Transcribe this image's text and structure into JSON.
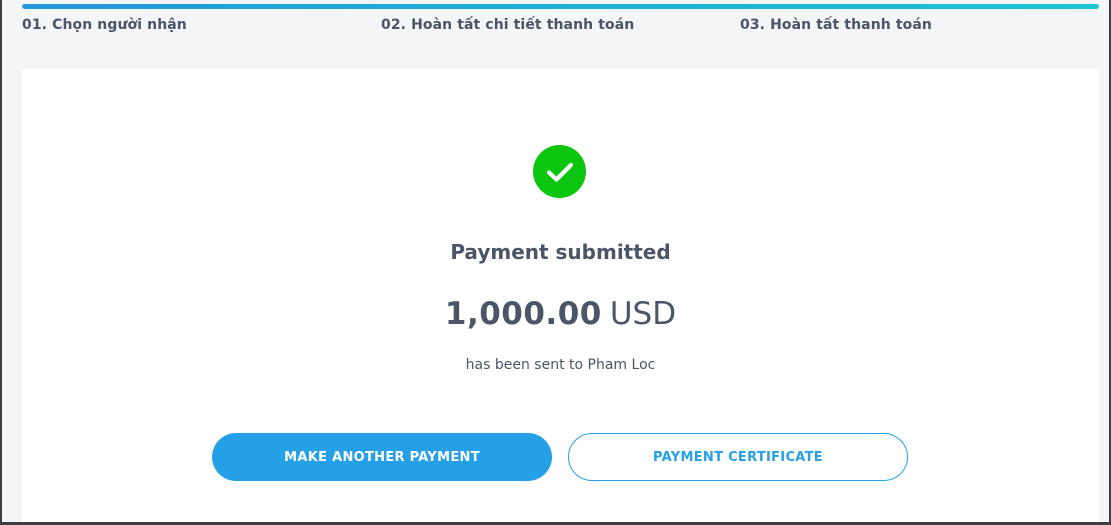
{
  "progress": {
    "current_step": 3,
    "total_steps": 3,
    "fraction_complete": 1.0,
    "gradient_start": "#2297db",
    "gradient_end": "#1cc4d1"
  },
  "steps": [
    {
      "label": "01. Chọn người nhận"
    },
    {
      "label": "02. Hoàn tất chi tiết thanh toán"
    },
    {
      "label": "03. Hoàn tất thanh toán"
    }
  ],
  "result": {
    "icon": "checkmark-circle-icon",
    "icon_color": "#0bc50f",
    "title": "Payment submitted",
    "amount": "1,000.00",
    "currency": "USD",
    "sent_message": "has been sent to Pham Loc"
  },
  "actions": {
    "make_another_label": "MAKE ANOTHER PAYMENT",
    "certificate_label": "PAYMENT CERTIFICATE",
    "accent_color": "#25a0e6"
  }
}
